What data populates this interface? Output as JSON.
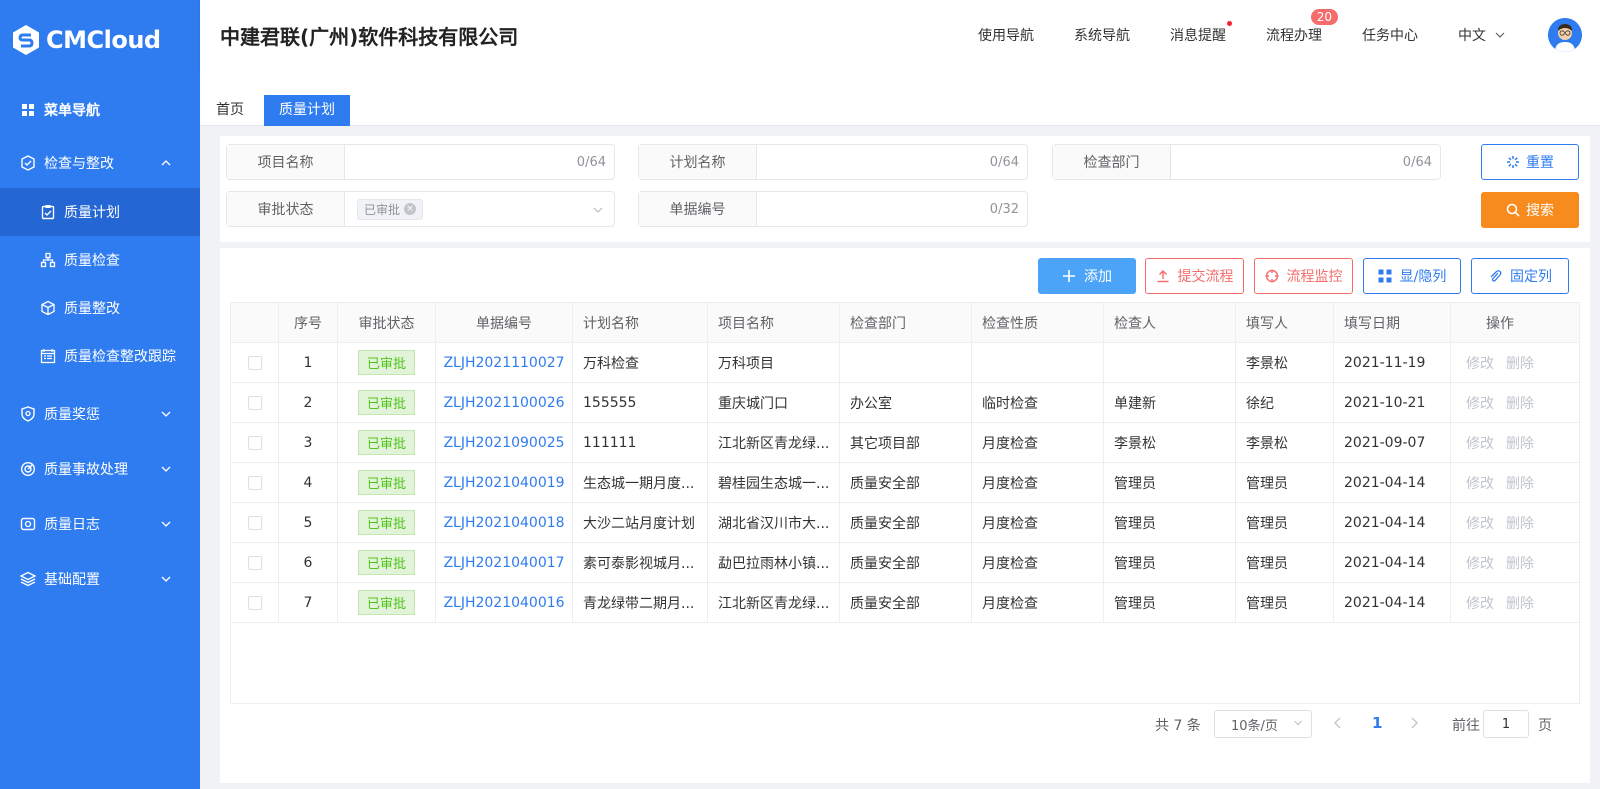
{
  "brand": {
    "logo_text": "CMCloud"
  },
  "company_name": "中建君联(广州)软件科技有限公司",
  "header_nav": {
    "usage_nav": "使用导航",
    "system_nav": "系统导航",
    "messages": "消息提醒",
    "process": "流程办理",
    "process_badge": "20",
    "tasks": "任务中心",
    "language": "中文"
  },
  "sidebar": {
    "menu_nav": "菜单导航",
    "inspect_rectify": "检查与整改",
    "sub": [
      "质量计划",
      "质量检查",
      "质量整改",
      "质量检查整改跟踪"
    ],
    "reward_penalty": "质量奖惩",
    "accident": "质量事故处理",
    "log": "质量日志",
    "config": "基础配置"
  },
  "tabs": {
    "home": "首页",
    "current": "质量计划"
  },
  "filters": {
    "project_name": {
      "label": "项目名称",
      "counter": "0/64"
    },
    "plan_name": {
      "label": "计划名称",
      "counter": "0/64"
    },
    "dept": {
      "label": "检查部门",
      "counter": "0/64"
    },
    "approval_status": {
      "label": "审批状态",
      "tag": "已审批"
    },
    "doc_no": {
      "label": "单据编号",
      "counter": "0/32"
    },
    "reset": "重置",
    "search": "搜索"
  },
  "toolbar": {
    "add": "添加",
    "submit_flow": "提交流程",
    "monitor_flow": "流程监控",
    "show_hide_cols": "显/隐列",
    "fixed_cols": "固定列"
  },
  "table": {
    "headers": [
      "序号",
      "审批状态",
      "单据编号",
      "计划名称",
      "项目名称",
      "检查部门",
      "检查性质",
      "检查人",
      "填写人",
      "填写日期",
      "操作"
    ],
    "op_edit": "修改",
    "op_delete": "删除",
    "rows": [
      [
        "1",
        "已审批",
        "ZLJH2021110027",
        "万科检查",
        "万科项目",
        "",
        "",
        "",
        "李景松",
        "2021-11-19"
      ],
      [
        "2",
        "已审批",
        "ZLJH2021100026",
        "155555",
        "重庆城门口",
        "办公室",
        "临时检查",
        "单建新",
        "徐纪",
        "2021-10-21"
      ],
      [
        "3",
        "已审批",
        "ZLJH2021090025",
        "111111",
        "江北新区青龙绿...",
        "其它项目部",
        "月度检查",
        "李景松",
        "李景松",
        "2021-09-07"
      ],
      [
        "4",
        "已审批",
        "ZLJH2021040019",
        "生态城一期月度...",
        "碧桂园生态城一...",
        "质量安全部",
        "月度检查",
        "管理员",
        "管理员",
        "2021-04-14"
      ],
      [
        "5",
        "已审批",
        "ZLJH2021040018",
        "大沙二站月度计划",
        "湖北省汉川市大...",
        "质量安全部",
        "月度检查",
        "管理员",
        "管理员",
        "2021-04-14"
      ],
      [
        "6",
        "已审批",
        "ZLJH2021040017",
        "素可泰影视城月...",
        "勐巴拉雨林小镇...",
        "质量安全部",
        "月度检查",
        "管理员",
        "管理员",
        "2021-04-14"
      ],
      [
        "7",
        "已审批",
        "ZLJH2021040016",
        "青龙绿带二期月...",
        "江北新区青龙绿...",
        "质量安全部",
        "月度检查",
        "管理员",
        "管理员",
        "2021-04-14"
      ]
    ]
  },
  "pagination": {
    "total": "共 7 条",
    "page_size": "10条/页",
    "current": "1",
    "goto": "前往",
    "goto_value": "1",
    "page_suffix": "页"
  },
  "colors": {
    "primary": "#2f7cf0",
    "orange": "#f78b1e",
    "danger": "#f56c6c",
    "success": "#52c41a"
  }
}
